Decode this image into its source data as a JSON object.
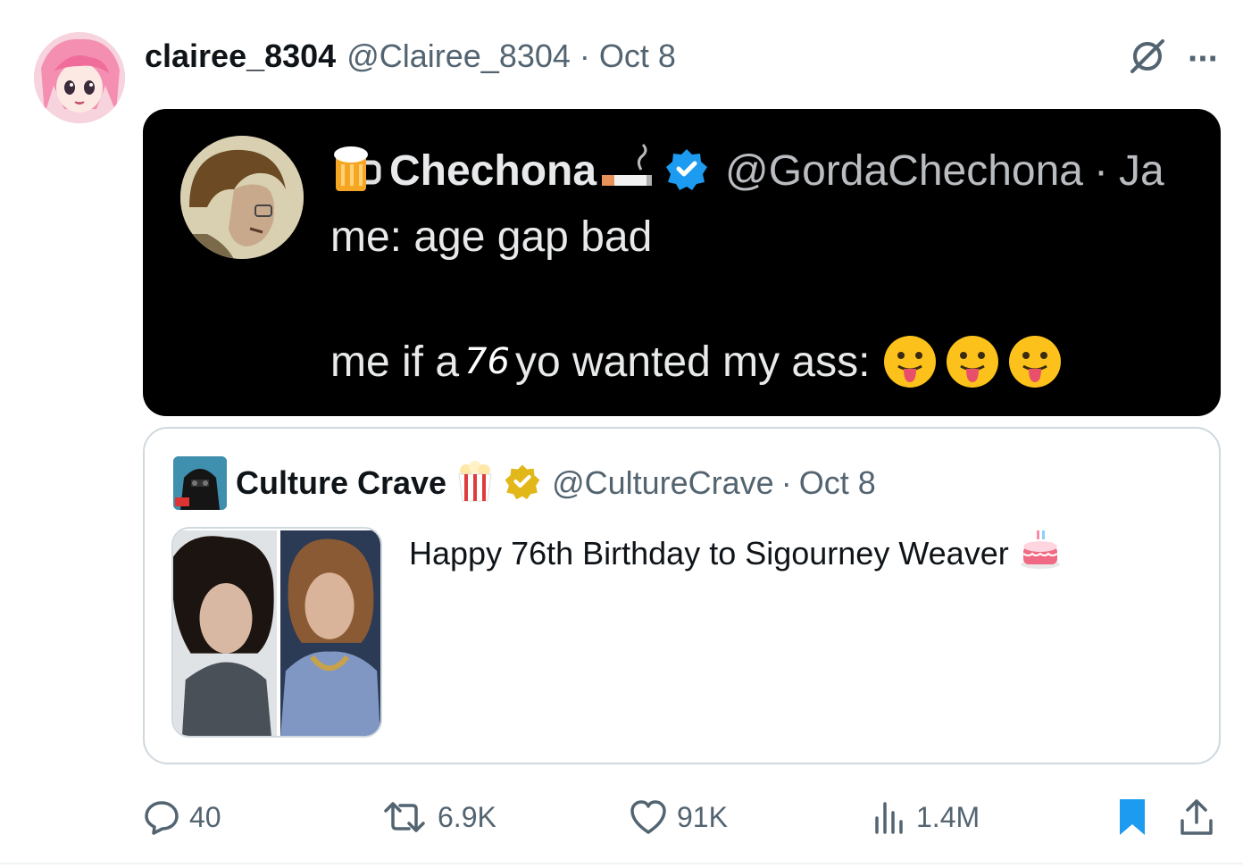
{
  "post": {
    "display_name": "clairee_8304",
    "handle": "@Clairee_8304",
    "separator": "·",
    "date": "Oct 8"
  },
  "screenshot": {
    "name": "Chechona",
    "handle": "@GordaChechona",
    "separator": "·",
    "date_partial": "Ja",
    "line1": "me: age gap bad",
    "line2_before": "me if a",
    "line2_number": "76",
    "line2_after": "yo wanted my ass:"
  },
  "quoted": {
    "name": "Culture Crave",
    "handle": "@CultureCrave",
    "separator": "·",
    "date": "Oct 8",
    "text": "Happy 76th Birthday to Sigourney Weaver"
  },
  "actions": {
    "replies": "40",
    "reposts": "6.9K",
    "likes": "91K",
    "views": "1.4M"
  },
  "colors": {
    "secondary_text": "#536471",
    "bookmark_active": "#1d9bf0",
    "verified_blue": "#1d9bf0",
    "verified_gold": "#e2b719"
  }
}
